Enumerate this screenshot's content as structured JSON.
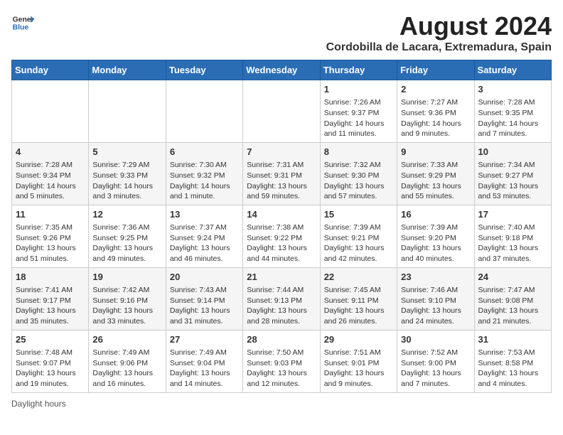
{
  "header": {
    "logo_general": "General",
    "logo_blue": "Blue",
    "title": "August 2024",
    "subtitle": "Cordobilla de Lacara, Extremadura, Spain"
  },
  "calendar": {
    "days_of_week": [
      "Sunday",
      "Monday",
      "Tuesday",
      "Wednesday",
      "Thursday",
      "Friday",
      "Saturday"
    ],
    "weeks": [
      [
        {
          "day": "",
          "info": ""
        },
        {
          "day": "",
          "info": ""
        },
        {
          "day": "",
          "info": ""
        },
        {
          "day": "",
          "info": ""
        },
        {
          "day": "1",
          "info": "Sunrise: 7:26 AM\nSunset: 9:37 PM\nDaylight: 14 hours and 11 minutes."
        },
        {
          "day": "2",
          "info": "Sunrise: 7:27 AM\nSunset: 9:36 PM\nDaylight: 14 hours and 9 minutes."
        },
        {
          "day": "3",
          "info": "Sunrise: 7:28 AM\nSunset: 9:35 PM\nDaylight: 14 hours and 7 minutes."
        }
      ],
      [
        {
          "day": "4",
          "info": "Sunrise: 7:28 AM\nSunset: 9:34 PM\nDaylight: 14 hours and 5 minutes."
        },
        {
          "day": "5",
          "info": "Sunrise: 7:29 AM\nSunset: 9:33 PM\nDaylight: 14 hours and 3 minutes."
        },
        {
          "day": "6",
          "info": "Sunrise: 7:30 AM\nSunset: 9:32 PM\nDaylight: 14 hours and 1 minute."
        },
        {
          "day": "7",
          "info": "Sunrise: 7:31 AM\nSunset: 9:31 PM\nDaylight: 13 hours and 59 minutes."
        },
        {
          "day": "8",
          "info": "Sunrise: 7:32 AM\nSunset: 9:30 PM\nDaylight: 13 hours and 57 minutes."
        },
        {
          "day": "9",
          "info": "Sunrise: 7:33 AM\nSunset: 9:29 PM\nDaylight: 13 hours and 55 minutes."
        },
        {
          "day": "10",
          "info": "Sunrise: 7:34 AM\nSunset: 9:27 PM\nDaylight: 13 hours and 53 minutes."
        }
      ],
      [
        {
          "day": "11",
          "info": "Sunrise: 7:35 AM\nSunset: 9:26 PM\nDaylight: 13 hours and 51 minutes."
        },
        {
          "day": "12",
          "info": "Sunrise: 7:36 AM\nSunset: 9:25 PM\nDaylight: 13 hours and 49 minutes."
        },
        {
          "day": "13",
          "info": "Sunrise: 7:37 AM\nSunset: 9:24 PM\nDaylight: 13 hours and 46 minutes."
        },
        {
          "day": "14",
          "info": "Sunrise: 7:38 AM\nSunset: 9:22 PM\nDaylight: 13 hours and 44 minutes."
        },
        {
          "day": "15",
          "info": "Sunrise: 7:39 AM\nSunset: 9:21 PM\nDaylight: 13 hours and 42 minutes."
        },
        {
          "day": "16",
          "info": "Sunrise: 7:39 AM\nSunset: 9:20 PM\nDaylight: 13 hours and 40 minutes."
        },
        {
          "day": "17",
          "info": "Sunrise: 7:40 AM\nSunset: 9:18 PM\nDaylight: 13 hours and 37 minutes."
        }
      ],
      [
        {
          "day": "18",
          "info": "Sunrise: 7:41 AM\nSunset: 9:17 PM\nDaylight: 13 hours and 35 minutes."
        },
        {
          "day": "19",
          "info": "Sunrise: 7:42 AM\nSunset: 9:16 PM\nDaylight: 13 hours and 33 minutes."
        },
        {
          "day": "20",
          "info": "Sunrise: 7:43 AM\nSunset: 9:14 PM\nDaylight: 13 hours and 31 minutes."
        },
        {
          "day": "21",
          "info": "Sunrise: 7:44 AM\nSunset: 9:13 PM\nDaylight: 13 hours and 28 minutes."
        },
        {
          "day": "22",
          "info": "Sunrise: 7:45 AM\nSunset: 9:11 PM\nDaylight: 13 hours and 26 minutes."
        },
        {
          "day": "23",
          "info": "Sunrise: 7:46 AM\nSunset: 9:10 PM\nDaylight: 13 hours and 24 minutes."
        },
        {
          "day": "24",
          "info": "Sunrise: 7:47 AM\nSunset: 9:08 PM\nDaylight: 13 hours and 21 minutes."
        }
      ],
      [
        {
          "day": "25",
          "info": "Sunrise: 7:48 AM\nSunset: 9:07 PM\nDaylight: 13 hours and 19 minutes."
        },
        {
          "day": "26",
          "info": "Sunrise: 7:49 AM\nSunset: 9:06 PM\nDaylight: 13 hours and 16 minutes."
        },
        {
          "day": "27",
          "info": "Sunrise: 7:49 AM\nSunset: 9:04 PM\nDaylight: 13 hours and 14 minutes."
        },
        {
          "day": "28",
          "info": "Sunrise: 7:50 AM\nSunset: 9:03 PM\nDaylight: 13 hours and 12 minutes."
        },
        {
          "day": "29",
          "info": "Sunrise: 7:51 AM\nSunset: 9:01 PM\nDaylight: 13 hours and 9 minutes."
        },
        {
          "day": "30",
          "info": "Sunrise: 7:52 AM\nSunset: 9:00 PM\nDaylight: 13 hours and 7 minutes."
        },
        {
          "day": "31",
          "info": "Sunrise: 7:53 AM\nSunset: 8:58 PM\nDaylight: 13 hours and 4 minutes."
        }
      ]
    ]
  },
  "footer": {
    "daylight_label": "Daylight hours"
  }
}
